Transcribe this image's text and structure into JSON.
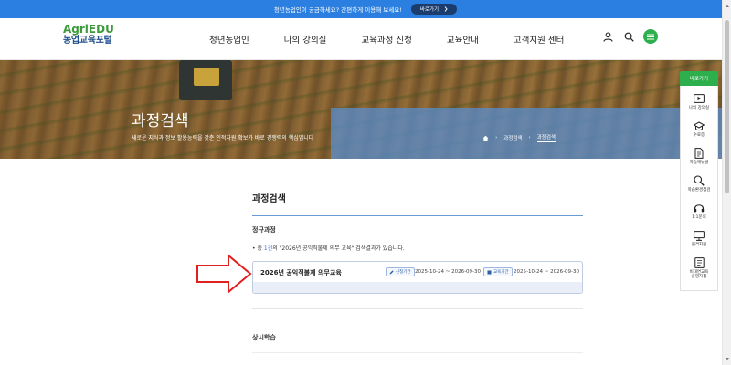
{
  "topbar": {
    "text": "청년농업인이 궁금하세요? 간편하게 이용해 보세요!",
    "button": "바로가기"
  },
  "logo": {
    "top": "AgriEDU",
    "bottom": "농업교육포털"
  },
  "gnb": [
    "청년농업인",
    "나의 강의실",
    "교육과정 신청",
    "교육안내",
    "고객지원 센터"
  ],
  "hero": {
    "title": "과정검색",
    "subtitle": "새로운 지식과 정보 활용능력을 갖춘 인적자원 확보가 바로 경쟁력의 핵심입니다",
    "breadcrumb": [
      "과정검색",
      "과정검색"
    ]
  },
  "main": {
    "page_title": "과정검색",
    "section1_title": "정규과정",
    "result_prefix": "• 총 ",
    "result_count": "1건",
    "result_suffix": "의 \"2026년 공익직불제 의무 교육\" 검색결과가 있습니다.",
    "course": {
      "name": "2026년 공익직불제 의무교육",
      "badge_apply": "신청기간",
      "apply_period": "2025-10-24 ~ 2026-09-30",
      "badge_edu": "교육기간",
      "edu_period": "2025-10-24 ~ 2026-09-30"
    },
    "section2_title": "상시학습"
  },
  "quick": {
    "head": "바로가기",
    "items": [
      {
        "label": "나의 강의실",
        "icon": "play-icon"
      },
      {
        "label": "수료증",
        "icon": "graduation-cap-icon"
      },
      {
        "label": "학습매뉴얼",
        "icon": "document-icon"
      },
      {
        "label": "학습환경점검",
        "icon": "magnifier-icon"
      },
      {
        "label": "1:1문의",
        "icon": "headset-icon"
      },
      {
        "label": "원격지원",
        "icon": "monitor-icon"
      },
      {
        "label": "비대면교육\n운영지침",
        "icon": "guide-icon"
      }
    ]
  },
  "colors": {
    "accent_green": "#2eaf4d",
    "topbar_blue": "#2b7fe0",
    "brand_navy": "#1f4f8a",
    "arrow_red": "#e02020"
  }
}
